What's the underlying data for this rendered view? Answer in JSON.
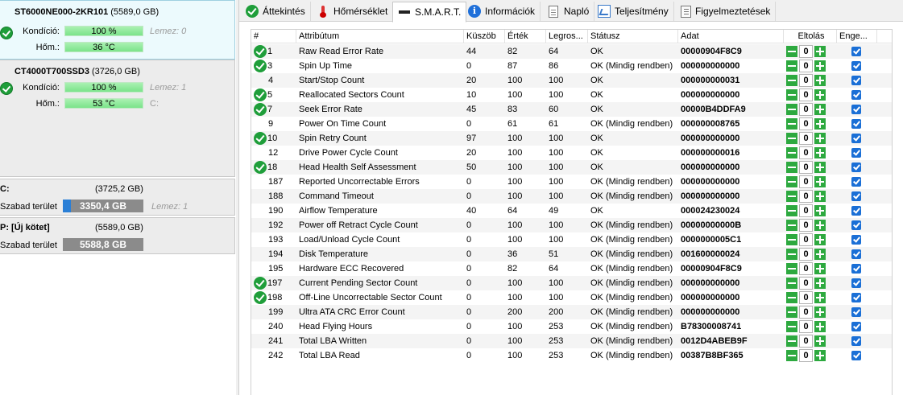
{
  "disks": [
    {
      "model": "ST6000NE000-2KR101",
      "capacity": "(5589,0 GB)",
      "health_label": "Kondíció:",
      "health_value": "100 %",
      "temp_label": "Hőm.:",
      "temp_value": "36 °C",
      "side_info_1": "Lemez: 0",
      "side_info_2": ""
    },
    {
      "model": "CT4000T700SSD3",
      "capacity": "(3726,0 GB)",
      "health_label": "Kondíció:",
      "health_value": "100 %",
      "temp_label": "Hőm.:",
      "temp_value": "53 °C",
      "side_info_1": "Lemez: 1",
      "side_info_2": "C:"
    }
  ],
  "volumes": [
    {
      "name": "C:",
      "size": "(3725,2 GB)",
      "free_label": "Szabad terület",
      "free_value": "3350,4 GB",
      "used_fraction": 0.1,
      "side_info": "Lemez: 1"
    },
    {
      "name": "P: [Új kötet]",
      "size": "(5589,0 GB)",
      "free_label": "Szabad terület",
      "free_value": "5588,8 GB",
      "used_fraction": 0.0,
      "side_info": ""
    }
  ],
  "tabs": [
    {
      "label": "Áttekintés",
      "icon": "check-icon"
    },
    {
      "label": "Hőmérséklet",
      "icon": "thermometer-icon"
    },
    {
      "label": "S.M.A.R.T.",
      "icon": "smart-icon"
    },
    {
      "label": "Információk",
      "icon": "info-icon"
    },
    {
      "label": "Napló",
      "icon": "log-icon"
    },
    {
      "label": "Teljesítmény",
      "icon": "chart-icon"
    },
    {
      "label": "Figyelmeztetések",
      "icon": "alerts-icon"
    }
  ],
  "active_tab": "S.M.A.R.T.",
  "table": {
    "headers": [
      "#",
      "Attribútum",
      "Küszöb",
      "Érték",
      "Legros...",
      "Státusz",
      "Adat",
      "Eltolás",
      "Enge..."
    ],
    "rows": [
      {
        "id": "1",
        "name": "Raw Read Error Rate",
        "thr": "44",
        "val": "82",
        "worst": "64",
        "status": "OK",
        "data": "00000904F8C9",
        "offset": "0",
        "ok": true
      },
      {
        "id": "3",
        "name": "Spin Up Time",
        "thr": "0",
        "val": "87",
        "worst": "86",
        "status": "OK (Mindig rendben)",
        "data": "000000000000",
        "offset": "0",
        "ok": true
      },
      {
        "id": "4",
        "name": "Start/Stop Count",
        "thr": "20",
        "val": "100",
        "worst": "100",
        "status": "OK",
        "data": "000000000031",
        "offset": "0",
        "ok": false
      },
      {
        "id": "5",
        "name": "Reallocated Sectors Count",
        "thr": "10",
        "val": "100",
        "worst": "100",
        "status": "OK",
        "data": "000000000000",
        "offset": "0",
        "ok": true
      },
      {
        "id": "7",
        "name": "Seek Error Rate",
        "thr": "45",
        "val": "83",
        "worst": "60",
        "status": "OK",
        "data": "00000B4DDFA9",
        "offset": "0",
        "ok": true
      },
      {
        "id": "9",
        "name": "Power On Time Count",
        "thr": "0",
        "val": "61",
        "worst": "61",
        "status": "OK (Mindig rendben)",
        "data": "000000008765",
        "offset": "0",
        "ok": false
      },
      {
        "id": "10",
        "name": "Spin Retry Count",
        "thr": "97",
        "val": "100",
        "worst": "100",
        "status": "OK",
        "data": "000000000000",
        "offset": "0",
        "ok": true
      },
      {
        "id": "12",
        "name": "Drive Power Cycle Count",
        "thr": "20",
        "val": "100",
        "worst": "100",
        "status": "OK",
        "data": "000000000016",
        "offset": "0",
        "ok": false
      },
      {
        "id": "18",
        "name": "Head Health Self Assessment",
        "thr": "50",
        "val": "100",
        "worst": "100",
        "status": "OK",
        "data": "000000000000",
        "offset": "0",
        "ok": true
      },
      {
        "id": "187",
        "name": "Reported Uncorrectable Errors",
        "thr": "0",
        "val": "100",
        "worst": "100",
        "status": "OK (Mindig rendben)",
        "data": "000000000000",
        "offset": "0",
        "ok": false
      },
      {
        "id": "188",
        "name": "Command Timeout",
        "thr": "0",
        "val": "100",
        "worst": "100",
        "status": "OK (Mindig rendben)",
        "data": "000000000000",
        "offset": "0",
        "ok": false
      },
      {
        "id": "190",
        "name": "Airflow Temperature",
        "thr": "40",
        "val": "64",
        "worst": "49",
        "status": "OK",
        "data": "000024230024",
        "offset": "0",
        "ok": false
      },
      {
        "id": "192",
        "name": "Power off Retract Cycle Count",
        "thr": "0",
        "val": "100",
        "worst": "100",
        "status": "OK (Mindig rendben)",
        "data": "00000000000B",
        "offset": "0",
        "ok": false
      },
      {
        "id": "193",
        "name": "Load/Unload Cycle Count",
        "thr": "0",
        "val": "100",
        "worst": "100",
        "status": "OK (Mindig rendben)",
        "data": "0000000005C1",
        "offset": "0",
        "ok": false
      },
      {
        "id": "194",
        "name": "Disk Temperature",
        "thr": "0",
        "val": "36",
        "worst": "51",
        "status": "OK (Mindig rendben)",
        "data": "001600000024",
        "offset": "0",
        "ok": false
      },
      {
        "id": "195",
        "name": "Hardware ECC Recovered",
        "thr": "0",
        "val": "82",
        "worst": "64",
        "status": "OK (Mindig rendben)",
        "data": "00000904F8C9",
        "offset": "0",
        "ok": false
      },
      {
        "id": "197",
        "name": "Current Pending Sector Count",
        "thr": "0",
        "val": "100",
        "worst": "100",
        "status": "OK (Mindig rendben)",
        "data": "000000000000",
        "offset": "0",
        "ok": true
      },
      {
        "id": "198",
        "name": "Off-Line Uncorrectable Sector Count",
        "thr": "0",
        "val": "100",
        "worst": "100",
        "status": "OK (Mindig rendben)",
        "data": "000000000000",
        "offset": "0",
        "ok": true
      },
      {
        "id": "199",
        "name": "Ultra ATA CRC Error Count",
        "thr": "0",
        "val": "200",
        "worst": "200",
        "status": "OK (Mindig rendben)",
        "data": "000000000000",
        "offset": "0",
        "ok": false
      },
      {
        "id": "240",
        "name": "Head Flying Hours",
        "thr": "0",
        "val": "100",
        "worst": "253",
        "status": "OK (Mindig rendben)",
        "data": "B78300008741",
        "offset": "0",
        "ok": false
      },
      {
        "id": "241",
        "name": "Total LBA Written",
        "thr": "0",
        "val": "100",
        "worst": "253",
        "status": "OK (Mindig rendben)",
        "data": "0012D4ABEB9F",
        "offset": "0",
        "ok": false
      },
      {
        "id": "242",
        "name": "Total LBA Read",
        "thr": "0",
        "val": "100",
        "worst": "253",
        "status": "OK (Mindig rendben)",
        "data": "00387B8BF365",
        "offset": "0",
        "ok": false
      }
    ]
  }
}
